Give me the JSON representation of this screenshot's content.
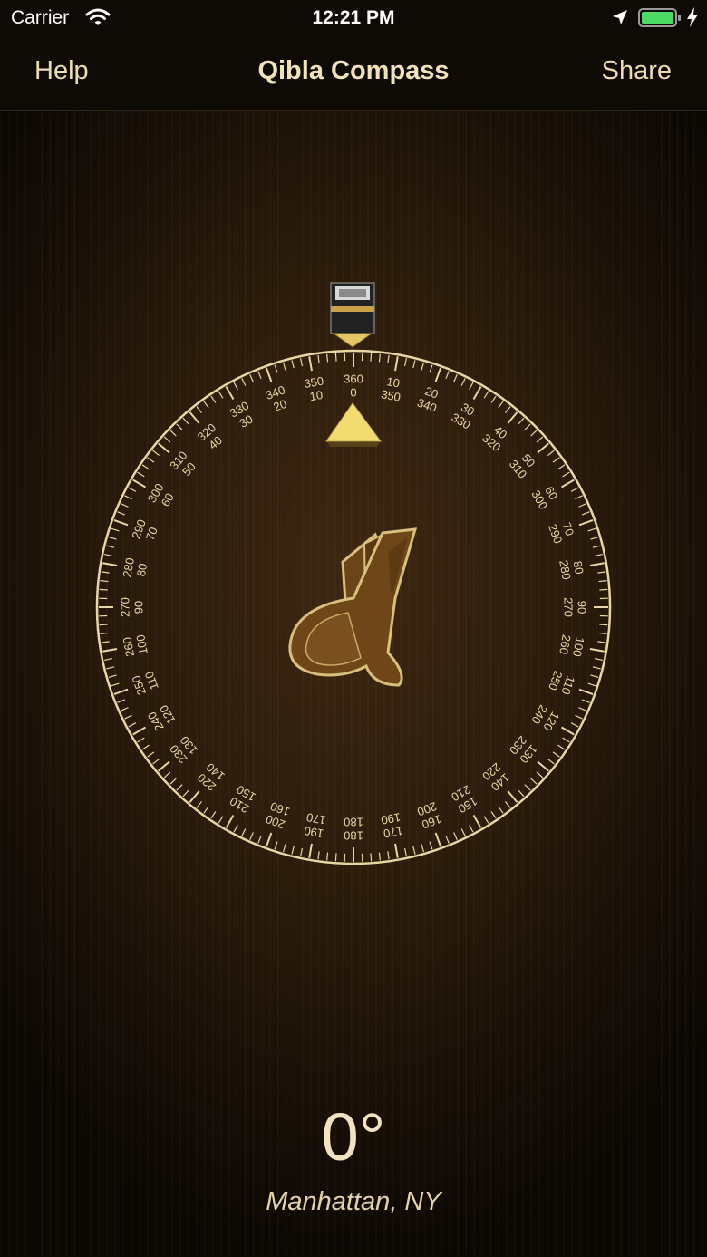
{
  "status_bar": {
    "carrier": "Carrier",
    "time": "12:21 PM",
    "battery_color": "#4cd964"
  },
  "nav": {
    "help_label": "Help",
    "title": "Qibla Compass",
    "share_label": "Share"
  },
  "compass": {
    "outer_labels": [
      "360",
      "10",
      "20",
      "30",
      "40",
      "50",
      "60",
      "70",
      "80",
      "90",
      "100",
      "110",
      "120",
      "130",
      "140",
      "150",
      "160",
      "170",
      "180",
      "190",
      "200",
      "210",
      "220",
      "230",
      "240",
      "250",
      "260",
      "270",
      "280",
      "290",
      "300",
      "310",
      "320",
      "330",
      "340",
      "350"
    ],
    "inner_labels": [
      "0",
      "350",
      "340",
      "330",
      "320",
      "310",
      "300",
      "290",
      "280",
      "270",
      "260",
      "250",
      "240",
      "230",
      "220",
      "210",
      "200",
      "190",
      "180",
      "170",
      "160",
      "150",
      "140",
      "130",
      "120",
      "110",
      "100",
      "90",
      "80",
      "70",
      "60",
      "50",
      "40",
      "30",
      "20",
      "10"
    ],
    "heading": 0,
    "qibla_bearing": 0,
    "center_icon": "crescent-logo-icon",
    "qibla_marker_icon": "kaaba-icon",
    "pointer_icon": "triangle-pointer-icon",
    "gold_color": "#e9d7a3",
    "pointer_color": "#f2dc72"
  },
  "readout": {
    "degrees": "0°",
    "location": "Manhattan, NY"
  }
}
